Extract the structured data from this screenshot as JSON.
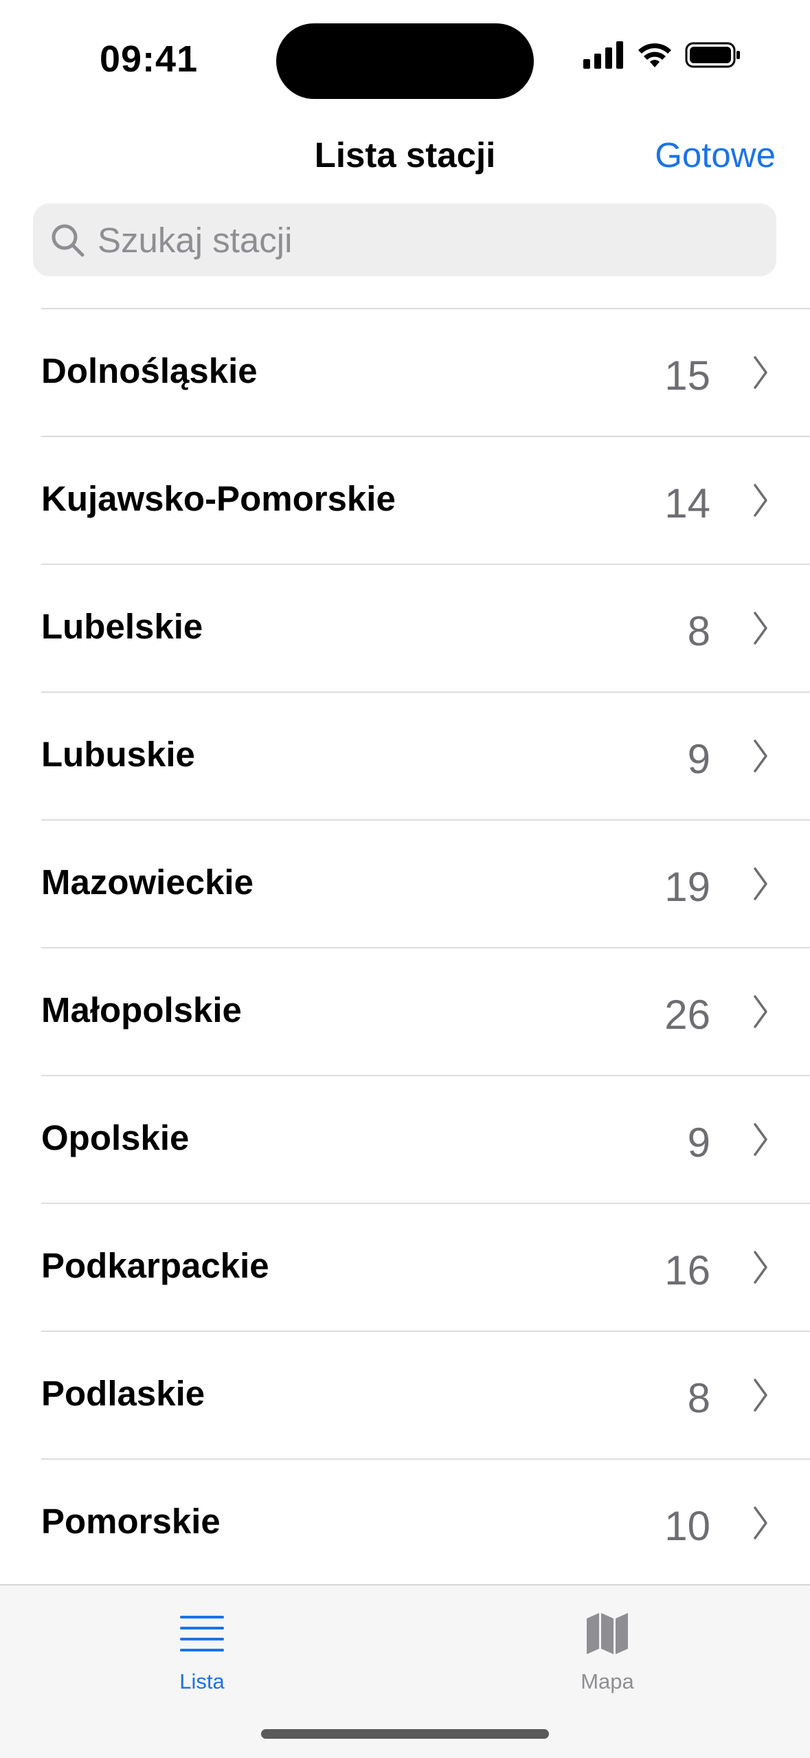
{
  "status_bar": {
    "time": "09:41"
  },
  "nav": {
    "title": "Lista stacji",
    "done_label": "Gotowe"
  },
  "search": {
    "placeholder": "Szukaj stacji",
    "value": ""
  },
  "regions": [
    {
      "name": "Dolnośląskie",
      "count": "15"
    },
    {
      "name": "Kujawsko-Pomorskie",
      "count": "14"
    },
    {
      "name": "Lubelskie",
      "count": "8"
    },
    {
      "name": "Lubuskie",
      "count": "9"
    },
    {
      "name": "Mazowieckie",
      "count": "19"
    },
    {
      "name": "Małopolskie",
      "count": "26"
    },
    {
      "name": "Opolskie",
      "count": "9"
    },
    {
      "name": "Podkarpackie",
      "count": "16"
    },
    {
      "name": "Podlaskie",
      "count": "8"
    },
    {
      "name": "Pomorskie",
      "count": "10"
    }
  ],
  "tabs": [
    {
      "label": "Lista",
      "icon": "list-icon",
      "selected": true
    },
    {
      "label": "Mapa",
      "icon": "map-icon",
      "selected": false
    }
  ],
  "colors": {
    "accent": "#1a73e8",
    "secondary_text": "#6d6d72",
    "separator": "#dcdcde",
    "search_bg": "#eeeeef",
    "tab_bar_bg": "#f6f6f6"
  }
}
